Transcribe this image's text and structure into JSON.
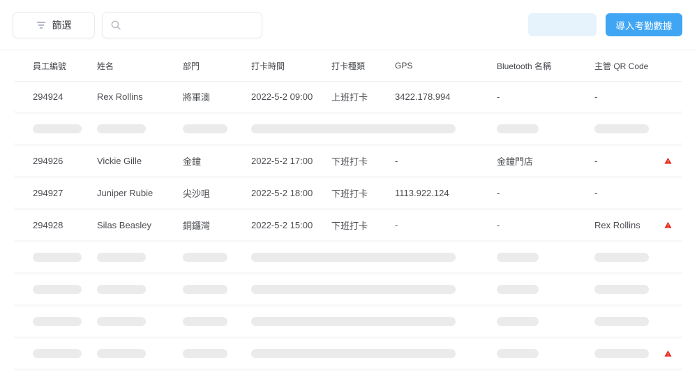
{
  "toolbar": {
    "filter": {
      "label": "篩選"
    },
    "search": {
      "value": "",
      "placeholder": ""
    },
    "import_button": {
      "label": "導入考勤數據"
    }
  },
  "table": {
    "columns": [
      "員工編號",
      "姓名",
      "部門",
      "打卡時間",
      "打卡種類",
      "GPS",
      "Bluetooth 名稱",
      "主管 QR Code"
    ],
    "rows": [
      {
        "type": "data",
        "employee_id": "294924",
        "name": "Rex Rollins",
        "department": "將軍澳",
        "time": "2022-5-2 09:00",
        "clock_type": "上班打卡",
        "gps": "3422.178.994",
        "bluetooth": "-",
        "qr": "-",
        "warning": false
      },
      {
        "type": "skeleton",
        "warning": false
      },
      {
        "type": "data",
        "employee_id": "294926",
        "name": "Vickie Gille",
        "department": "金鐘",
        "time": "2022-5-2 17:00",
        "clock_type": "下班打卡",
        "gps": "-",
        "bluetooth": "金鐘門店",
        "qr": "-",
        "warning": true
      },
      {
        "type": "data",
        "employee_id": "294927",
        "name": "Juniper Rubie",
        "department": "尖沙咀",
        "time": "2022-5-2 18:00",
        "clock_type": "下班打卡",
        "gps": "1113.922.124",
        "bluetooth": "-",
        "qr": "-",
        "warning": false
      },
      {
        "type": "data",
        "employee_id": "294928",
        "name": "Silas Beasley",
        "department": "銅鑼灣",
        "time": "2022-5-2 15:00",
        "clock_type": "下班打卡",
        "gps": "-",
        "bluetooth": "-",
        "qr": "Rex Rollins",
        "warning": true
      },
      {
        "type": "skeleton",
        "warning": false
      },
      {
        "type": "skeleton",
        "warning": false
      },
      {
        "type": "skeleton",
        "warning": false
      },
      {
        "type": "skeleton",
        "warning": true
      }
    ]
  },
  "colors": {
    "accent": "#40a6f3",
    "accent-light": "#e6f3fd",
    "warning": "#e5261b",
    "skeleton": "#ebebeb"
  }
}
